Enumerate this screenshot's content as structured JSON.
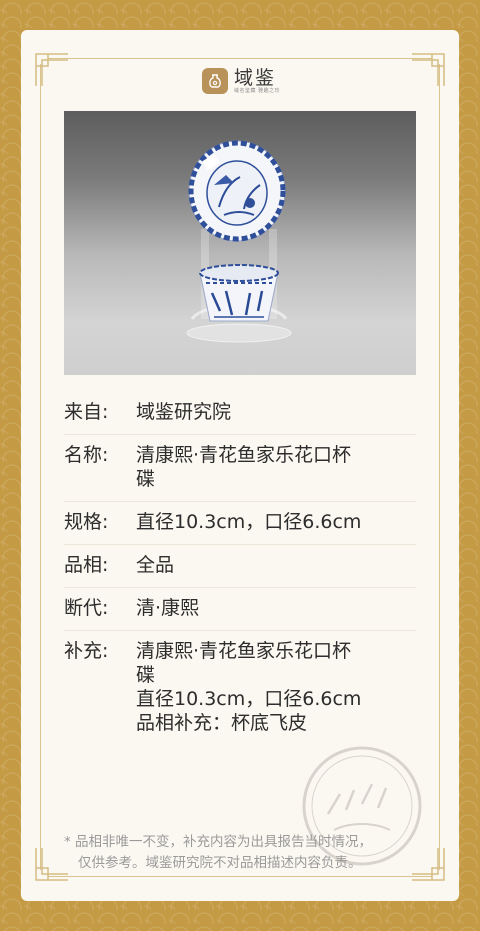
{
  "brand": {
    "name": "域鉴",
    "tagline": "域名鉴藏 雅趣之珍"
  },
  "product_photo": {
    "alt": "清康熙·青花鱼家乐花口杯碟"
  },
  "details": [
    {
      "label": "来自:",
      "lines": [
        "域鉴研究院"
      ]
    },
    {
      "label": "名称:",
      "lines": [
        "清康熙·青花鱼家乐花口杯",
        "碟"
      ]
    },
    {
      "label": "规格:",
      "lines": [
        "直径10.3cm，口径6.6cm"
      ]
    },
    {
      "label": "品相:",
      "lines": [
        "全品"
      ]
    },
    {
      "label": "断代:",
      "lines": [
        "清·康熙"
      ]
    },
    {
      "label": "补充:",
      "lines": [
        "清康熙·青花鱼家乐花口杯",
        "碟",
        "直径10.3cm，口径6.6cm",
        "品相补充：杯底飞皮"
      ]
    }
  ],
  "footer": {
    "line1": "* 品相非唯一不变，补充内容为出具报告当时情况，",
    "line2": "仅供参考。域鉴研究院不对品相描述内容负责。"
  },
  "colors": {
    "background": "#c49a44",
    "card": "#fbf8f1",
    "frame": "#d9c48f",
    "logo": "#b9925a",
    "text": "#2d2d2d"
  }
}
